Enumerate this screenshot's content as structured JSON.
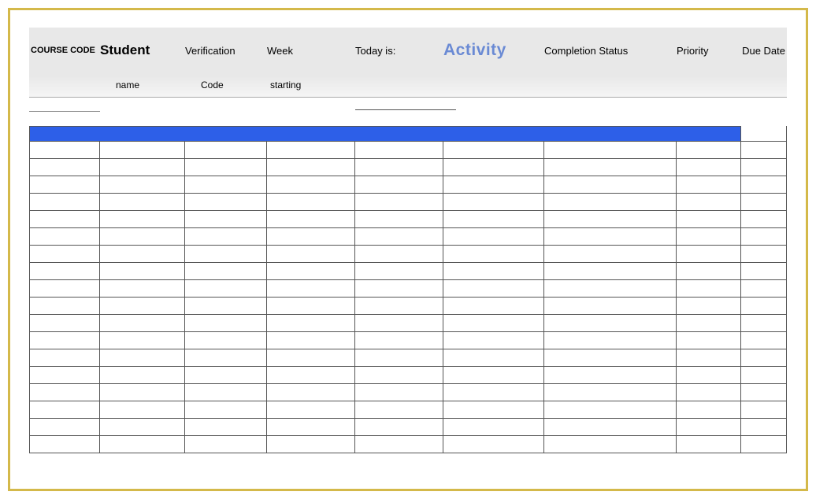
{
  "headers": {
    "course_code": "COURSE CODE",
    "student": "Student",
    "verification": "Verification",
    "week": "Week",
    "today_is": "Today is:",
    "activity": "Activity",
    "completion_status": "Completion Status",
    "priority": "Priority",
    "due_date": "Due Date"
  },
  "subheaders": {
    "name": "name",
    "code": "Code",
    "starting": "starting"
  },
  "colors": {
    "accent_blue": "#2d5fe8",
    "activity_text": "#6a8ad4",
    "frame_border": "#d4b94a"
  },
  "data_row_count": 18
}
